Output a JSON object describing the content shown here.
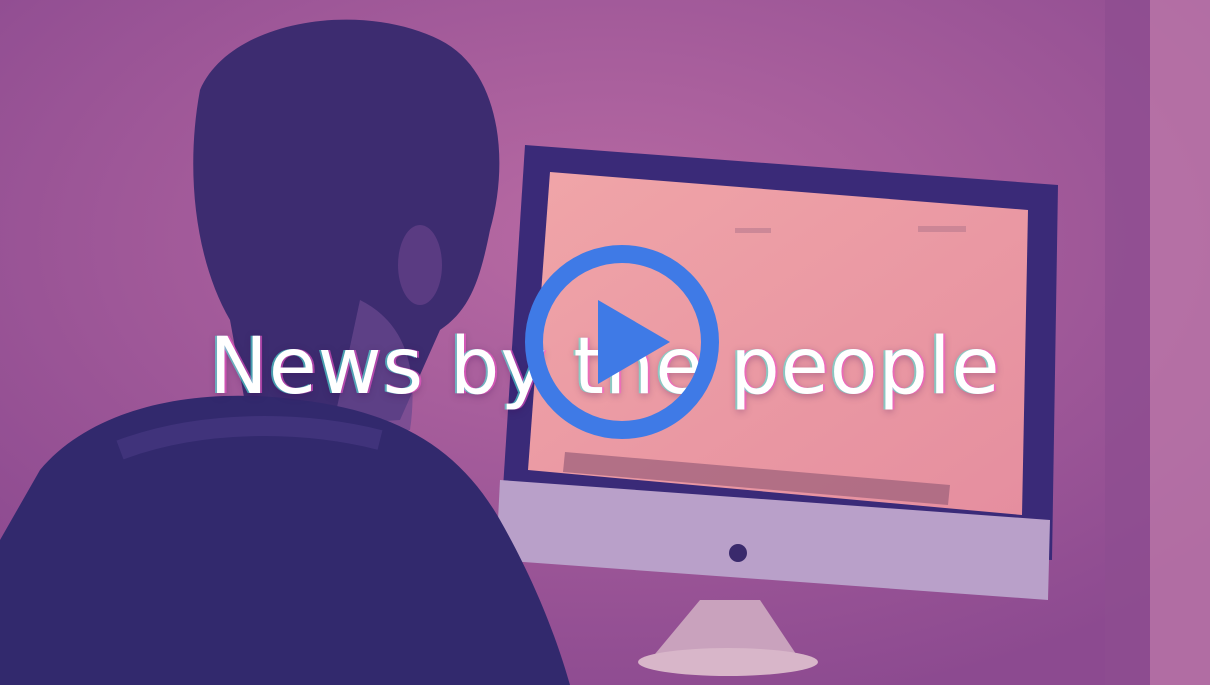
{
  "video": {
    "headline": "News by the people",
    "play_label": "Play video",
    "accent_color": "#3f7ae6",
    "overlay_color": "#a65a99"
  }
}
